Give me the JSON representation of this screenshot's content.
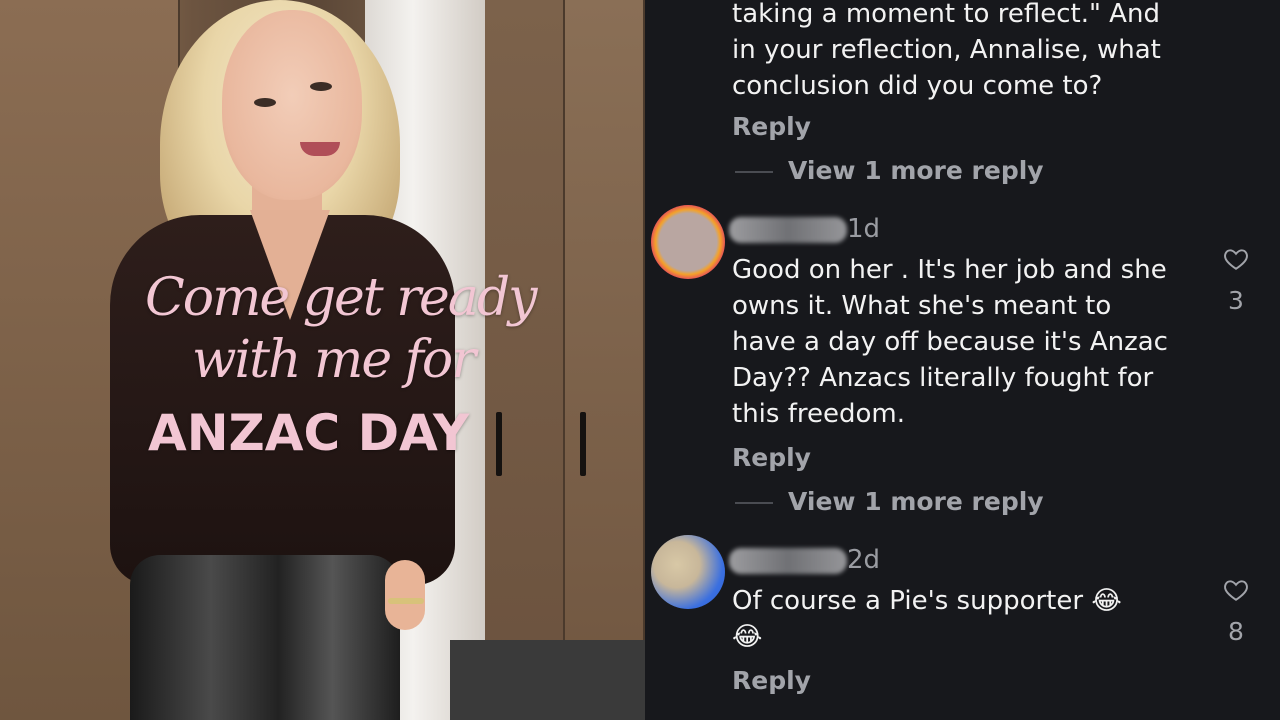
{
  "overlay": {
    "line1": "Come get ready",
    "line2": "with me for",
    "line3": "ANZAC DAY"
  },
  "comments": {
    "top_thread": {
      "text_lines": [
        "taking a moment to reflect.\" And",
        "in your reflection, Annalise, what",
        "conclusion did you come to?"
      ],
      "reply_label": "Reply",
      "more_replies": "View 1 more reply"
    },
    "items": [
      {
        "age": "1d",
        "text_lines": [
          "Good on her . It's her job and she",
          "owns it. What she's meant to",
          "have a day off because it's Anzac",
          "Day?? Anzacs literally fought for",
          "this freedom."
        ],
        "likes": "3",
        "reply_label": "Reply",
        "more_replies": "View 1 more reply",
        "avatar_colors": [
          "#e0306a",
          "#f3a22a"
        ]
      },
      {
        "age": "2d",
        "text_lines": [
          "Of course a Pie's supporter 😂",
          "😂"
        ],
        "likes": "8",
        "reply_label": "Reply",
        "avatar_colors": [
          "#2f6de0",
          "#c8b79a"
        ]
      }
    ]
  },
  "icons": {
    "like": "heart-icon"
  },
  "colors": {
    "panel_bg": "#17181c",
    "overlay_pink": "#f2c6d3",
    "muted_text": "#a2a4aa"
  }
}
